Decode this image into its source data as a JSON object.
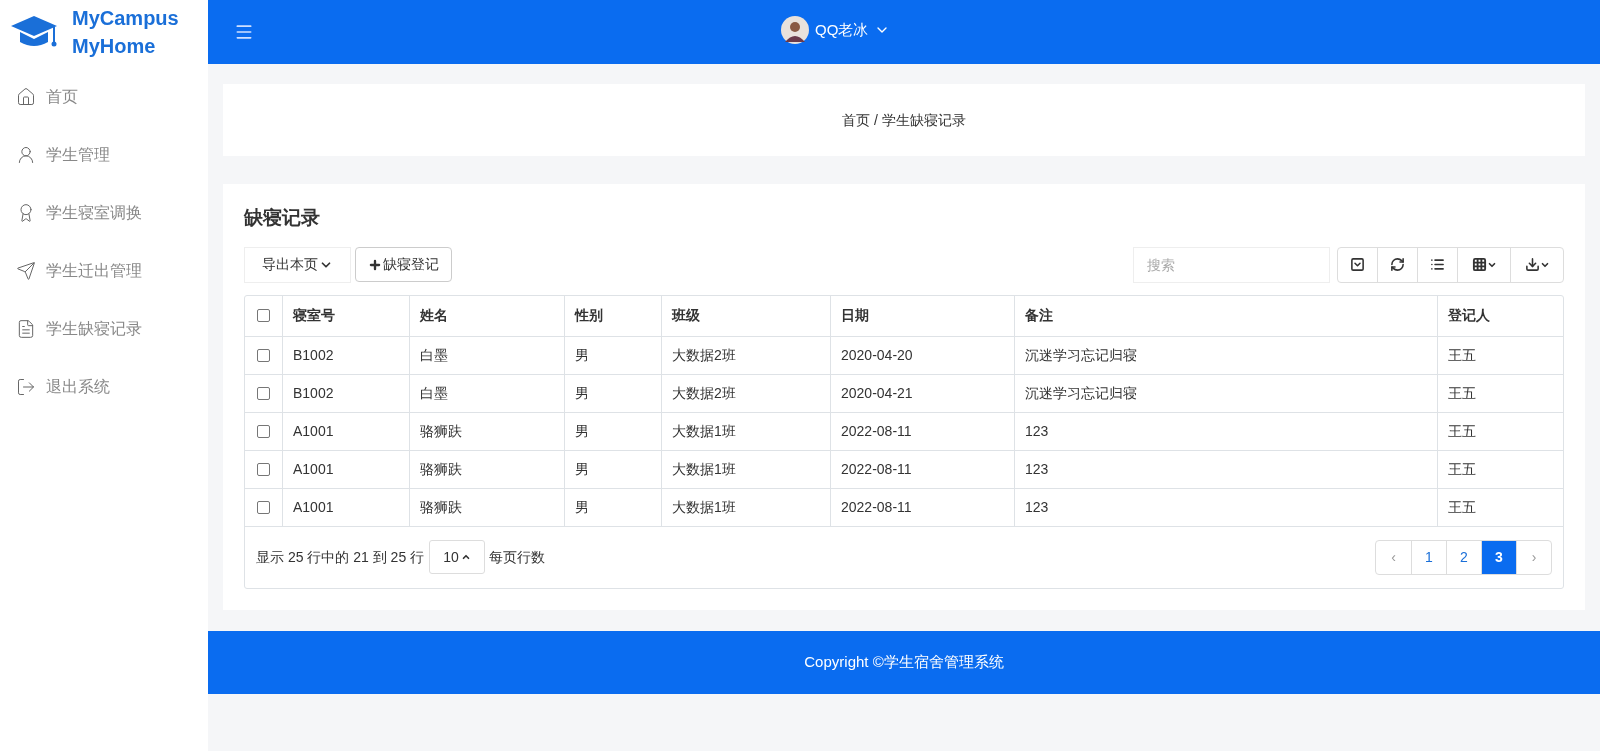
{
  "logo": {
    "line1": "MyCampus",
    "line2": "MyHome"
  },
  "sidebar": {
    "items": [
      {
        "label": "首页",
        "selected": false
      },
      {
        "label": "学生管理",
        "selected": false
      },
      {
        "label": "学生寝室调换",
        "selected": false
      },
      {
        "label": "学生迁出管理",
        "selected": false
      },
      {
        "label": "学生缺寝记录",
        "selected": false
      },
      {
        "label": "退出系统",
        "selected": false
      }
    ]
  },
  "header": {
    "user": "QQ老冰"
  },
  "breadcrumb": "首页 / 学生缺寝记录",
  "panel": {
    "title": "缺寝记录",
    "export_select": "导出本页",
    "add_button": "缺寝登记",
    "search": {
      "placeholder": "搜索"
    },
    "table": {
      "header_checked": false,
      "columns": [
        "寝室号",
        "姓名",
        "性别",
        "班级",
        "日期",
        "备注",
        "登记人"
      ],
      "rows": [
        {
          "checked": false,
          "cells": [
            "B1002",
            "白墨",
            "男",
            "大数据2班",
            "2020-04-20",
            "沉迷学习忘记归寝",
            "王五"
          ]
        },
        {
          "checked": false,
          "cells": [
            "B1002",
            "白墨",
            "男",
            "大数据2班",
            "2020-04-21",
            "沉迷学习忘记归寝",
            "王五"
          ]
        },
        {
          "checked": false,
          "cells": [
            "A1001",
            "骆狮趺",
            "男",
            "大数据1班",
            "2022-08-11",
            "123",
            "王五"
          ]
        },
        {
          "checked": false,
          "cells": [
            "A1001",
            "骆狮趺",
            "男",
            "大数据1班",
            "2022-08-11",
            "123",
            "王五"
          ]
        },
        {
          "checked": false,
          "cells": [
            "A1001",
            "骆狮趺",
            "男",
            "大数据1班",
            "2022-08-11",
            "123",
            "王五"
          ]
        }
      ]
    },
    "pagination": {
      "info": "显示 25 行中的 21 到 25 行",
      "page_size": "10",
      "per_page_label": "每页行数",
      "prev": "‹",
      "next": "›",
      "pages": [
        {
          "label": "1",
          "selected": false
        },
        {
          "label": "2",
          "selected": false
        },
        {
          "label": "3",
          "selected": true
        }
      ]
    }
  },
  "footer": "Copyright ©学生宿舍管理系统"
}
